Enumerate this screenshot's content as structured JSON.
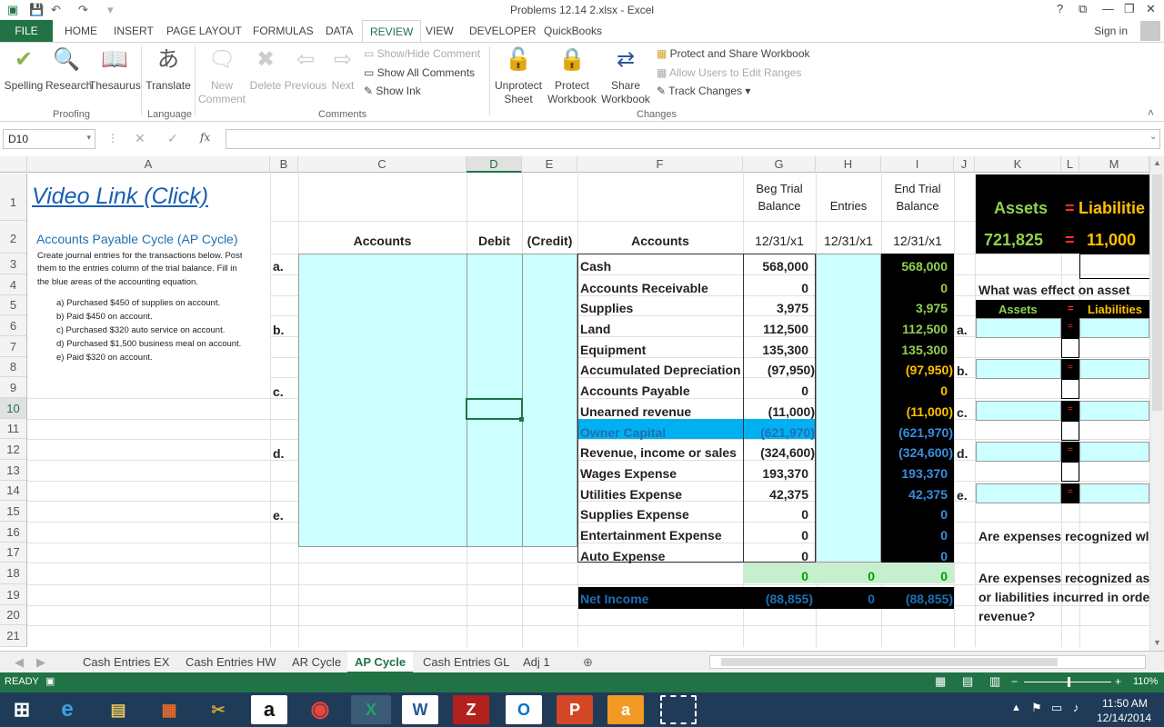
{
  "window": {
    "title": "Problems 12.14 2.xlsx - Excel",
    "help": "?",
    "restore": "⧉",
    "minimize": "—",
    "maximize": "❐",
    "close": "✕"
  },
  "ribbon_tabs": [
    "FILE",
    "HOME",
    "INSERT",
    "PAGE LAYOUT",
    "FORMULAS",
    "DATA",
    "REVIEW",
    "VIEW",
    "DEVELOPER",
    "QuickBooks"
  ],
  "active_tab": "REVIEW",
  "sign_in": "Sign in",
  "ribbon": {
    "proofing": {
      "spelling": "Spelling",
      "research": "Research",
      "thesaurus": "Thesaurus",
      "label": "Proofing"
    },
    "language": {
      "translate": "Translate",
      "label": "Language"
    },
    "comments": {
      "new_comment_1": "New",
      "new_comment_2": "Comment",
      "delete": "Delete",
      "previous": "Previous",
      "next": "Next",
      "show_hide": "Show/Hide Comment",
      "show_all": "Show All Comments",
      "show_ink": "Show Ink",
      "label": "Comments"
    },
    "changes": {
      "unprotect_1": "Unprotect",
      "unprotect_2": "Sheet",
      "protect_1": "Protect",
      "protect_2": "Workbook",
      "share_1": "Share",
      "share_2": "Workbook",
      "protect_share": "Protect and Share Workbook",
      "allow_users": "Allow Users to Edit Ranges",
      "track_changes": "Track Changes ▾",
      "label": "Changes"
    }
  },
  "formula_bar": {
    "name_box": "D10",
    "cancel": "✕",
    "enter": "✓",
    "fx": "fx",
    "value": ""
  },
  "columns": [
    "A",
    "B",
    "C",
    "D",
    "E",
    "F",
    "G",
    "H",
    "I",
    "J",
    "K",
    "L",
    "M"
  ],
  "rows": [
    "1",
    "2",
    "3",
    "4",
    "5",
    "6",
    "7",
    "8",
    "9",
    "10",
    "11",
    "12",
    "13",
    "14",
    "15",
    "16",
    "17",
    "18",
    "19",
    "20",
    "21"
  ],
  "sheet": {
    "video_link": "Video Link (Click)",
    "section_title": "Accounts Payable Cycle (AP Cycle)",
    "instructions_1": "Create journal entries for the transactions below. Post",
    "instructions_2": "them to the entries column of the trial balance. Fill in",
    "instructions_3": "the blue areas of the accounting equation.",
    "transactions": [
      "a)   Purchased $450 of supplies on account.",
      "b)   Paid $450 on account.",
      "c)   Purchased $320 auto service on account.",
      "d)   Purchased $1,500 business meal on account.",
      "e)   Paid $320 on account."
    ],
    "entry_letters": [
      "a.",
      "b.",
      "c.",
      "d.",
      "e."
    ],
    "journal_headers": {
      "accounts": "Accounts",
      "debit": "Debit",
      "credit": "(Credit)"
    },
    "tb_headers": {
      "accounts": "Accounts",
      "beg_1": "Beg Trial",
      "beg_2": "Balance",
      "entries": "Entries",
      "end_1": "End Trial",
      "end_2": "Balance",
      "date_g": "12/31/x1",
      "date_h": "12/31/x1",
      "date_i": "12/31/x1"
    },
    "accounts": [
      {
        "name": "Cash",
        "beg": "568,000",
        "end": "568,000"
      },
      {
        "name": "Accounts Receivable",
        "beg": "0",
        "end": "0"
      },
      {
        "name": "Supplies",
        "beg": "3,975",
        "end": "3,975"
      },
      {
        "name": "Land",
        "beg": "112,500",
        "end": "112,500"
      },
      {
        "name": "Equipment",
        "beg": "135,300",
        "end": "135,300"
      },
      {
        "name": "Accumulated Depreciation",
        "beg": "(97,950)",
        "end": "(97,950)"
      },
      {
        "name": "Accounts Payable",
        "beg": "0",
        "end": "0"
      },
      {
        "name": "Unearned revenue",
        "beg": "(11,000)",
        "end": "(11,000)"
      },
      {
        "name": "Owner Capital",
        "beg": "(621,970)",
        "end": "(621,970)"
      },
      {
        "name": "Revenue, income or sales",
        "beg": "(324,600)",
        "end": "(324,600)"
      },
      {
        "name": "Wages Expense",
        "beg": "193,370",
        "end": "193,370"
      },
      {
        "name": "Utilities Expense",
        "beg": "42,375",
        "end": "42,375"
      },
      {
        "name": "Supplies Expense",
        "beg": "0",
        "end": "0"
      },
      {
        "name": "Entertainment Expense",
        "beg": "0",
        "end": "0"
      },
      {
        "name": "Auto Expense",
        "beg": "0",
        "end": "0"
      }
    ],
    "totals": {
      "beg": "0",
      "entries": "0",
      "end": "0"
    },
    "net_income": {
      "label": "Net Income",
      "beg": "(88,855)",
      "entries": "0",
      "end": "(88,855)"
    },
    "equation": {
      "assets_label": "Assets",
      "eq": "=",
      "liabilities_label": "Liabilitie",
      "assets_value": "721,825",
      "liabilities_value": "11,000",
      "question": "What was effect on asset",
      "assets_small": "Assets",
      "liabilities_small": "Liabilities",
      "letters": [
        "a.",
        "b.",
        "c.",
        "d.",
        "e."
      ]
    },
    "q_expenses_1": "Are expenses recognized wl",
    "q_expenses_2a": "Are expenses recognized as",
    "q_expenses_2b": "or liabilities incurred in orde",
    "q_expenses_2c": "revenue?"
  },
  "sheet_tabs": [
    "Cash Entries EX",
    "Cash Entries HW",
    "AR Cycle",
    "AP Cycle",
    "Cash Entries GL",
    "Adj 1"
  ],
  "active_sheet": "AP Cycle",
  "status": {
    "mode": "READY",
    "zoom": "110%"
  },
  "taskbar": {
    "time": "11:50 AM",
    "date": "12/14/2014"
  },
  "colors": {
    "excel_green": "#217346",
    "cyan": "#ccffff",
    "tb_green": "#c6efce",
    "owner_blue": "#00b0f0",
    "end_green": "#92d050",
    "end_orange": "#ffc000"
  }
}
